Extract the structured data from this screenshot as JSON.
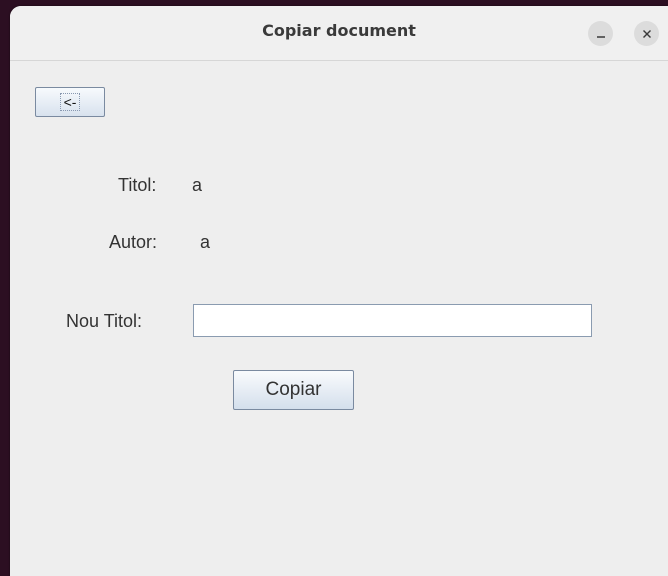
{
  "window": {
    "title": "Copiar document"
  },
  "toolbar": {
    "back_label": "<-"
  },
  "document": {
    "title_label": "Titol:",
    "title_value": "a",
    "author_label": "Autor:",
    "author_value": "a"
  },
  "form": {
    "new_title_label": "Nou Titol:",
    "new_title_value": "",
    "copy_label": "Copiar"
  },
  "icons": {
    "minimize": "minimize-icon",
    "close": "close-icon"
  }
}
